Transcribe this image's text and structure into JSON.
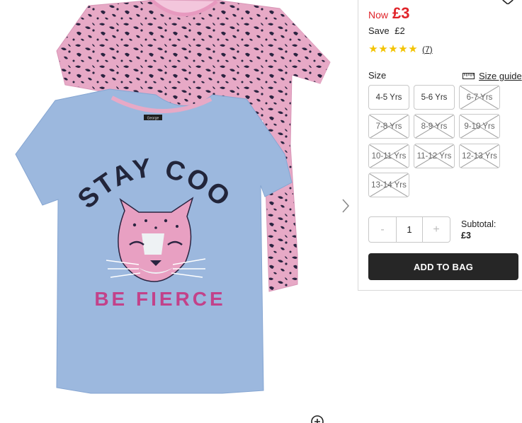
{
  "price": {
    "now_label": "Now",
    "now": "£3",
    "save_label": "Save",
    "save_amount": "£2"
  },
  "rating": {
    "stars": 5,
    "max": 5,
    "reviews": "(7)"
  },
  "size": {
    "label": "Size",
    "guide_label": "Size guide",
    "options": [
      {
        "label": "4-5 Yrs",
        "available": true
      },
      {
        "label": "5-6 Yrs",
        "available": true
      },
      {
        "label": "6-7 Yrs",
        "available": false
      },
      {
        "label": "7-8 Yrs",
        "available": false
      },
      {
        "label": "8-9 Yrs",
        "available": false
      },
      {
        "label": "9-10 Yrs",
        "available": false
      },
      {
        "label": "10-11 Yrs",
        "available": false
      },
      {
        "label": "11-12 Yrs",
        "available": false
      },
      {
        "label": "12-13 Yrs",
        "available": false
      },
      {
        "label": "13-14 Yrs",
        "available": false
      }
    ]
  },
  "quantity": {
    "minus": "-",
    "value": "1",
    "plus": "+"
  },
  "subtotal": {
    "label": "Subtotal:",
    "value": "£3"
  },
  "add_to_bag": "ADD TO BAG",
  "product_image": {
    "front_print_top": "STAY COOL",
    "front_print_bottom": "BE FIERCE",
    "brand_label": "George",
    "colors": {
      "blue_tee": "#9cb8de",
      "pink_tee": "#e7a9c6",
      "spot": "#2a2440",
      "accent": "#e0242a"
    }
  },
  "icons": {
    "next": "chevron-right-icon",
    "zoom": "zoom-in-icon",
    "wishlist": "heart-icon",
    "size_guide": "ruler-icon"
  }
}
